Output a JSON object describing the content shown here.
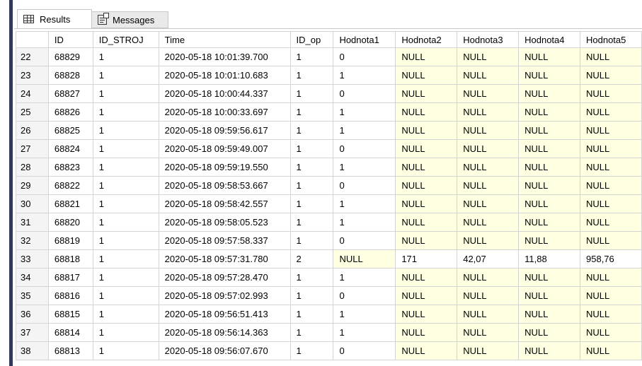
{
  "tabs": [
    {
      "label": "Results",
      "icon": "grid-icon"
    },
    {
      "label": "Messages",
      "icon": "messages-icon"
    }
  ],
  "colors": {
    "null_cell": "#ffffe1",
    "left_bar": "#2b3a67"
  },
  "columns": [
    "ID",
    "ID_STROJ",
    "Time",
    "ID_op",
    "Hodnota1",
    "Hodnota2",
    "Hodnota3",
    "Hodnota4",
    "Hodnota5"
  ],
  "rows": [
    [
      "22",
      "68829",
      "1",
      "2020-05-18 10:01:39.700",
      "1",
      "0",
      "NULL",
      "NULL",
      "NULL",
      "NULL"
    ],
    [
      "23",
      "68828",
      "1",
      "2020-05-18 10:01:10.683",
      "1",
      "1",
      "NULL",
      "NULL",
      "NULL",
      "NULL"
    ],
    [
      "24",
      "68827",
      "1",
      "2020-05-18 10:00:44.337",
      "1",
      "0",
      "NULL",
      "NULL",
      "NULL",
      "NULL"
    ],
    [
      "25",
      "68826",
      "1",
      "2020-05-18 10:00:33.697",
      "1",
      "1",
      "NULL",
      "NULL",
      "NULL",
      "NULL"
    ],
    [
      "26",
      "68825",
      "1",
      "2020-05-18 09:59:56.617",
      "1",
      "1",
      "NULL",
      "NULL",
      "NULL",
      "NULL"
    ],
    [
      "27",
      "68824",
      "1",
      "2020-05-18 09:59:49.007",
      "1",
      "0",
      "NULL",
      "NULL",
      "NULL",
      "NULL"
    ],
    [
      "28",
      "68823",
      "1",
      "2020-05-18 09:59:19.550",
      "1",
      "1",
      "NULL",
      "NULL",
      "NULL",
      "NULL"
    ],
    [
      "29",
      "68822",
      "1",
      "2020-05-18 09:58:53.667",
      "1",
      "0",
      "NULL",
      "NULL",
      "NULL",
      "NULL"
    ],
    [
      "30",
      "68821",
      "1",
      "2020-05-18 09:58:42.557",
      "1",
      "1",
      "NULL",
      "NULL",
      "NULL",
      "NULL"
    ],
    [
      "31",
      "68820",
      "1",
      "2020-05-18 09:58:05.523",
      "1",
      "1",
      "NULL",
      "NULL",
      "NULL",
      "NULL"
    ],
    [
      "32",
      "68819",
      "1",
      "2020-05-18 09:57:58.337",
      "1",
      "0",
      "NULL",
      "NULL",
      "NULL",
      "NULL"
    ],
    [
      "33",
      "68818",
      "1",
      "2020-05-18 09:57:31.780",
      "2",
      "NULL",
      "171",
      "42,07",
      "11,88",
      "958,76"
    ],
    [
      "34",
      "68817",
      "1",
      "2020-05-18 09:57:28.470",
      "1",
      "1",
      "NULL",
      "NULL",
      "NULL",
      "NULL"
    ],
    [
      "35",
      "68816",
      "1",
      "2020-05-18 09:57:02.993",
      "1",
      "0",
      "NULL",
      "NULL",
      "NULL",
      "NULL"
    ],
    [
      "36",
      "68815",
      "1",
      "2020-05-18 09:56:51.413",
      "1",
      "1",
      "NULL",
      "NULL",
      "NULL",
      "NULL"
    ],
    [
      "37",
      "68814",
      "1",
      "2020-05-18 09:56:14.363",
      "1",
      "1",
      "NULL",
      "NULL",
      "NULL",
      "NULL"
    ],
    [
      "38",
      "68813",
      "1",
      "2020-05-18 09:56:07.670",
      "1",
      "0",
      "NULL",
      "NULL",
      "NULL",
      "NULL"
    ]
  ]
}
